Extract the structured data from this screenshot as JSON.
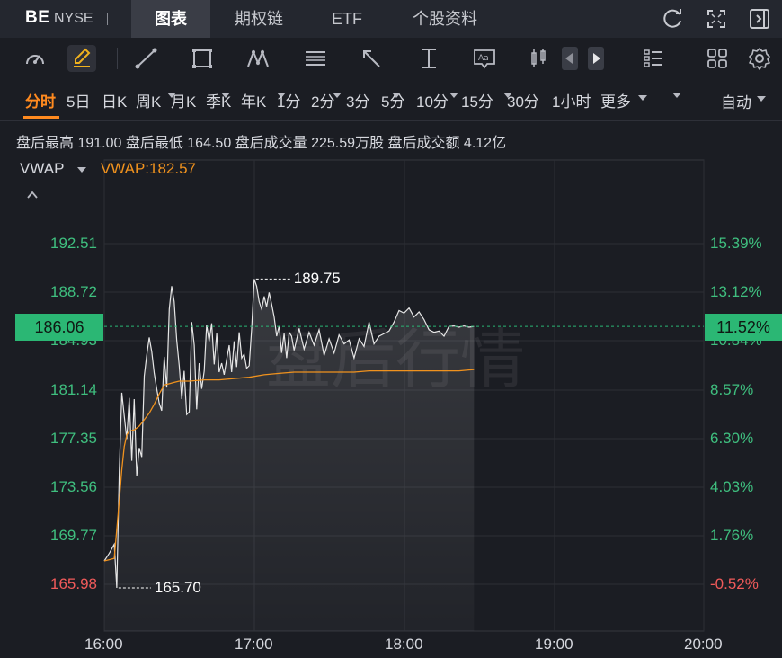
{
  "header": {
    "ticker": "BE",
    "exchange": "NYSE",
    "tabs": [
      "图表",
      "期权链",
      "ETF",
      "个股资料"
    ],
    "active_tab": "图表",
    "icons": [
      "refresh-icon",
      "fullscreen-icon",
      "collapse-panel-icon"
    ]
  },
  "toolbar": {
    "icons": [
      "gauge-icon",
      "draw-pen-icon",
      "trendline-icon",
      "rectangle-icon",
      "pattern-icon",
      "fib-icon",
      "arrow-icon",
      "measure-icon",
      "text-annotation-icon",
      "candle-style-icon",
      "scroll-left-icon",
      "scroll-right-icon",
      "indicator-list-icon",
      "layout-grid-icon",
      "settings-icon"
    ]
  },
  "periods": {
    "items": [
      "分时",
      "5日",
      "日K",
      "周K",
      "月K",
      "季K",
      "年K",
      "1分",
      "2分",
      "3分",
      "5分",
      "10分",
      "15分",
      "30分",
      "1小时",
      "更多"
    ],
    "active": "分时",
    "auto_label": "自动"
  },
  "stats": {
    "text": "盘后最高 191.00 盘后最低 164.50 盘后成交量 225.59万股 盘后成交额 4.12亿"
  },
  "indicator": {
    "name": "VWAP",
    "value_label": "VWAP:182.57"
  },
  "watermark": "盘后行情",
  "colors": {
    "price_line": "#e6e6e6",
    "vwap_line": "#f0921e",
    "up": "#3fbf7f",
    "down": "#f05a5a",
    "current": "#2bb774"
  },
  "chart_data": {
    "type": "line",
    "y_left_ticks": [
      "192.51",
      "188.72",
      "184.93",
      "181.14",
      "177.35",
      "173.56",
      "169.77",
      "165.98"
    ],
    "y_right_ticks": [
      "15.39%",
      "13.12%",
      "10.84%",
      "8.57%",
      "6.30%",
      "4.03%",
      "1.76%",
      "-0.52%"
    ],
    "x_ticks": [
      "16:00",
      "17:00",
      "18:00",
      "19:00",
      "20:00"
    ],
    "xlim": [
      "16:00",
      "20:00"
    ],
    "ylim": [
      163.6,
      195.2
    ],
    "current_price": "186.06",
    "current_pct": "11.52%",
    "high_label": "189.75",
    "low_label": "165.70",
    "series": [
      {
        "name": "price",
        "x_minutes": [
          0,
          2,
          4,
          5,
          6,
          7,
          8,
          9,
          10,
          11,
          12,
          13,
          14,
          15,
          16,
          17,
          18,
          19,
          20,
          21,
          22,
          23,
          24,
          25,
          26,
          27,
          28,
          29,
          30,
          31,
          32,
          33,
          34,
          35,
          36,
          37,
          38,
          39,
          40,
          41,
          42,
          43,
          44,
          45,
          46,
          47,
          48,
          49,
          50,
          51,
          52,
          53,
          54,
          55,
          56,
          57,
          58,
          59,
          60,
          61,
          62,
          63,
          64,
          65,
          66,
          67,
          68,
          69,
          70,
          71,
          72,
          73,
          74,
          75,
          76,
          78,
          80,
          82,
          84,
          86,
          88,
          90,
          92,
          94,
          96,
          98,
          100,
          102,
          104,
          106,
          108,
          110,
          112,
          114,
          116,
          118,
          120,
          122,
          124,
          126,
          128,
          130,
          132,
          134,
          136,
          138,
          140,
          142,
          144,
          146,
          148
        ],
        "values": [
          167.8,
          168.4,
          169.1,
          165.7,
          174.8,
          180.9,
          179.1,
          177.3,
          180.5,
          175.6,
          180.4,
          174.4,
          176.6,
          175.9,
          182.2,
          183.8,
          185.2,
          184.1,
          182.4,
          181.2,
          180.1,
          179.5,
          183.7,
          181.3,
          187.4,
          189.2,
          188.0,
          185.0,
          183.0,
          180.4,
          182.6,
          179.2,
          179.4,
          186.4,
          184.6,
          179.6,
          183.2,
          181.2,
          182.6,
          186.2,
          184.9,
          186.3,
          183.1,
          185.5,
          182.5,
          183.2,
          182.3,
          183.5,
          184.6,
          182.5,
          184.9,
          182.9,
          185.6,
          183.6,
          183.9,
          182.8,
          183.0,
          185.9,
          189.75,
          189.2,
          188.0,
          187.4,
          188.4,
          187.6,
          188.7,
          187.8,
          186.8,
          185.3,
          186.1,
          184.0,
          185.5,
          183.6,
          185.6,
          185.3,
          184.2,
          185.9,
          184.3,
          185.6,
          184.6,
          185.8,
          183.8,
          185.1,
          184.0,
          185.4,
          184.7,
          185.0,
          183.6,
          185.1,
          184.5,
          186.4,
          184.7,
          185.3,
          185.5,
          185.7,
          186.4,
          187.3,
          187.1,
          187.5,
          186.8,
          187.2,
          186.6,
          185.8,
          185.6,
          185.7,
          185.3,
          186.06,
          186.1,
          186.0,
          186.1,
          186.0,
          186.06
        ]
      },
      {
        "name": "VWAP",
        "x_minutes": [
          0,
          2,
          4,
          6,
          7,
          8,
          9,
          10,
          12,
          14,
          16,
          18,
          20,
          22,
          24,
          26,
          28,
          30,
          34,
          40,
          46,
          52,
          58,
          64,
          70,
          76,
          82,
          88,
          94,
          100,
          106,
          112,
          118,
          124,
          130,
          136,
          142,
          148
        ],
        "values": [
          167.8,
          167.9,
          168.0,
          172.5,
          174.9,
          176.7,
          177.6,
          177.9,
          178.0,
          178.3,
          178.8,
          179.3,
          180.0,
          180.8,
          181.5,
          181.6,
          181.7,
          181.8,
          181.8,
          181.9,
          181.9,
          182.0,
          182.1,
          182.3,
          182.4,
          182.5,
          182.5,
          182.5,
          182.5,
          182.5,
          182.6,
          182.6,
          182.6,
          182.6,
          182.6,
          182.6,
          182.6,
          182.7
        ]
      }
    ]
  }
}
